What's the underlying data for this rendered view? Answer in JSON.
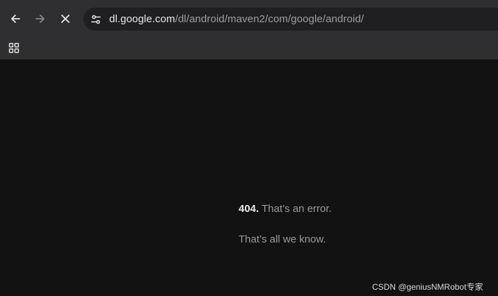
{
  "toolbar": {
    "back_icon": "arrow-left-icon",
    "forward_icon": "arrow-right-icon",
    "stop_icon": "close-icon",
    "site_info_icon": "tune-icon"
  },
  "omnibox": {
    "url_host": "dl.google.com",
    "url_path": "/dl/android/maven2/com/google/android/"
  },
  "bookmarks_bar": {
    "apps_icon": "apps-grid-icon"
  },
  "error": {
    "code": "404.",
    "message": " That’s an error.",
    "detail": "That’s all we know."
  },
  "watermark": "CSDN @geniusNMRobot专家",
  "colors": {
    "toolbar_bg": "#2f2f31",
    "omnibox_bg": "#1f1f21",
    "page_bg": "#121212",
    "text_primary": "#e8eaed",
    "text_muted": "#9a9a9a"
  }
}
